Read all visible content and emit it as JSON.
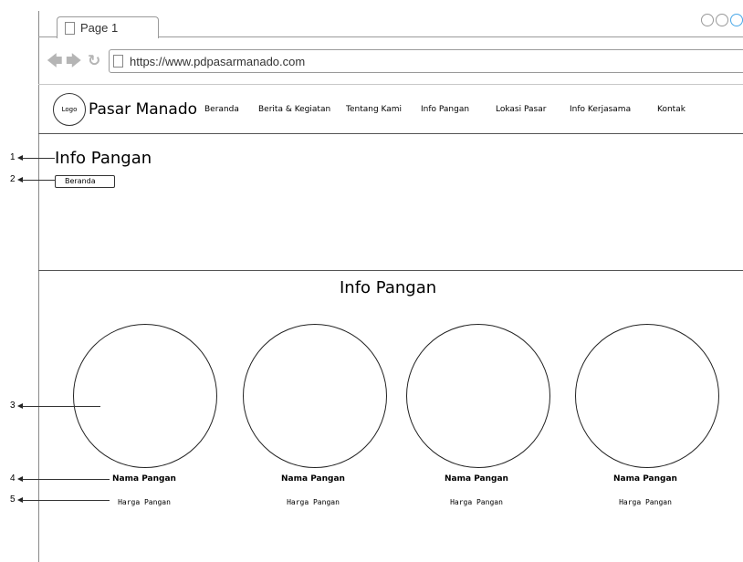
{
  "browser": {
    "tab_title": "Page 1",
    "url": "https://www.pdpasarmanado.com",
    "back_glyph": "🡄",
    "forward_glyph": "🡆",
    "reload_glyph": "↻"
  },
  "header": {
    "logo_text": "Logo",
    "site_name": "Pasar Manado",
    "menu": [
      {
        "label": "Beranda"
      },
      {
        "label": "Berita & Kegiatan"
      },
      {
        "label": "Tentang Kami"
      },
      {
        "label": "Info Pangan"
      },
      {
        "label": "Lokasi Pasar"
      },
      {
        "label": "Info Kerjasama"
      },
      {
        "label": "Kontak"
      }
    ]
  },
  "hero": {
    "title": "Info Pangan",
    "breadcrumb": "Beranda"
  },
  "content": {
    "section_title": "Info Pangan",
    "items": [
      {
        "name": "Nama Pangan",
        "price": "Harga Pangan"
      },
      {
        "name": "Nama Pangan",
        "price": "Harga Pangan"
      },
      {
        "name": "Nama Pangan",
        "price": "Harga Pangan"
      },
      {
        "name": "Nama Pangan",
        "price": "Harga Pangan"
      }
    ]
  },
  "callouts": [
    "1",
    "2",
    "3",
    "4",
    "5"
  ],
  "colors": {
    "accent": "#4aa8e8",
    "chrome_gray": "#b5b5b5",
    "line": "#555555"
  }
}
